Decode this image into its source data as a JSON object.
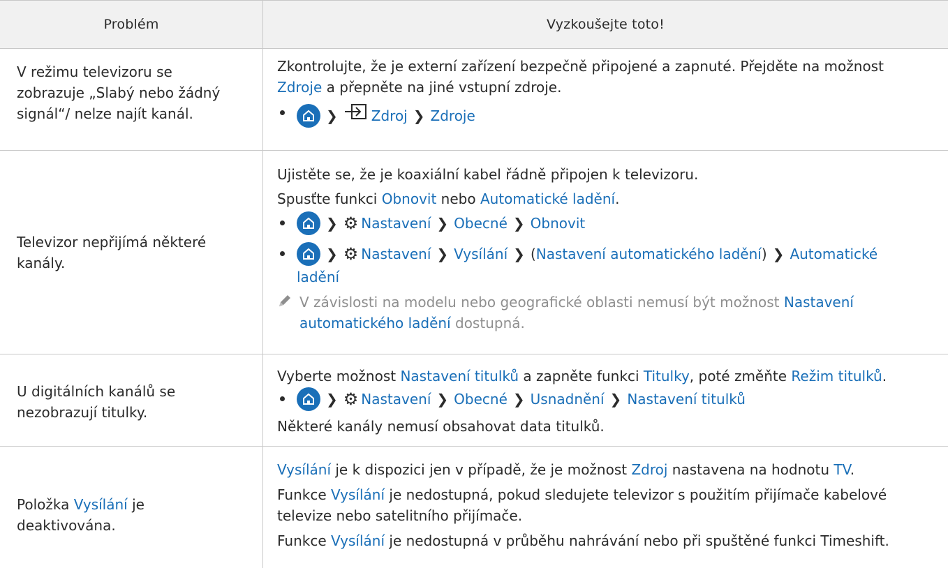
{
  "header": {
    "col1": "Problém",
    "col2": "Vyzkoušejte toto!"
  },
  "rows": [
    {
      "problem": [
        "V režimu televizoru se",
        "zobrazuje „Slabý nebo žádný",
        "signál“/ nelze najít kanál."
      ],
      "sol_line1": "Zkontrolujte, že je externí zařízení bezpečně připojené a zapnuté. Přejděte na možnost",
      "sol_line2_link": "Zdroje",
      "sol_line2_rest": " a přepněte na jiné vstupní zdroje.",
      "path": [
        "Zdroj",
        "Zdroje"
      ]
    },
    {
      "problem": [
        "Televizor nepřijímá některé",
        "kanály."
      ],
      "sol_line1": "Ujistěte se, že je koaxiální kabel řádně připojen k televizoru.",
      "sol_line2_a": "Spusťte funkci ",
      "sol_line2_link1": "Obnovit",
      "sol_line2_b": " nebo ",
      "sol_line2_link2": "Automatické ladění",
      "sol_line2_c": ".",
      "path1": [
        "Nastavení",
        "Obecné",
        "Obnovit"
      ],
      "path2": [
        "Nastavení",
        "Vysílání",
        "Nastavení automatického ladění",
        "Automatické",
        "ladění"
      ],
      "note_a": "V závislosti na modelu nebo geografické oblasti nemusí být možnost ",
      "note_link1": "Nastavení",
      "note_link2": "automatického ladění",
      "note_b": " dostupná."
    },
    {
      "problem": [
        "U digitálních kanálů se",
        "nezobrazují titulky."
      ],
      "sol_a": "Vyberte možnost ",
      "sol_link1": "Nastavení titulků",
      "sol_b": " a zapněte funkci ",
      "sol_link2": "Titulky",
      "sol_c": ", poté změňte ",
      "sol_link3": "Režim titulků",
      "sol_d": ".",
      "path": [
        "Nastavení",
        "Obecné",
        "Usnadnění",
        "Nastavení titulků"
      ],
      "sol_last": "Některé kanály nemusí obsahovat data titulků."
    },
    {
      "problem_a": "Položka ",
      "problem_link": "Vysílání",
      "problem_b": " je",
      "problem_line2": "deaktivována.",
      "l1_link1": "Vysílání",
      "l1_a": " je k dispozici jen v případě, že je možnost ",
      "l1_link2": "Zdroj",
      "l1_b": " nastavena na hodnotu ",
      "l1_link3": "TV",
      "l1_c": ".",
      "l2_a": "Funkce ",
      "l2_link": "Vysílání",
      "l2_b": " je nedostupná, pokud sledujete televizor s použitím přijímače kabelové",
      "l3": "televize nebo satelitního přijímače.",
      "l4_a": "Funkce ",
      "l4_link": "Vysílání",
      "l4_b": " je nedostupná v průběhu nahrávání nebo při spuštěné funkci Timeshift."
    }
  ],
  "colors": {
    "link": "#1a6fb8",
    "header_bg": "#f1f1f1",
    "border": "#c8c8c8",
    "note": "#8f8f8f"
  },
  "icons": [
    "home-icon",
    "chevron-right-icon",
    "source-icon",
    "gear-icon",
    "pencil-icon"
  ]
}
